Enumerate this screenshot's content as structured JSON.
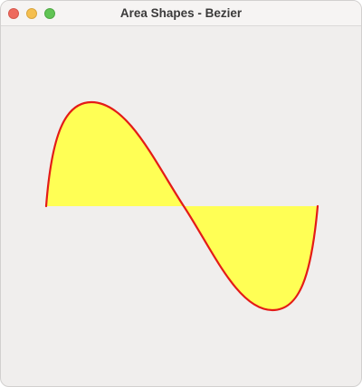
{
  "window": {
    "title": "Area Shapes - Bezier"
  },
  "titlebar": {
    "buttons": [
      {
        "name": "close",
        "color": "#ee6a5e"
      },
      {
        "name": "minimize",
        "color": "#f5bf4f"
      },
      {
        "name": "maximize",
        "color": "#61c454"
      }
    ]
  },
  "shape": {
    "type": "bezier-area",
    "fill_color": "#ffff55",
    "stroke_color": "#e41b17"
  },
  "colors": {
    "window_bg": "#f0eeed",
    "titlebar_bg": "#f6f4f3"
  }
}
